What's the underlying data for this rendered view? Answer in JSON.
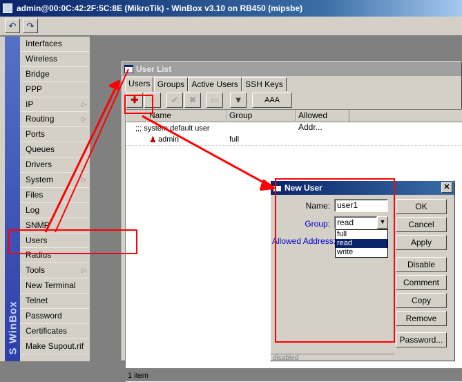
{
  "window_title": "admin@00:0C:42:2F:5C:8E (MikroTik) - WinBox v3.10 on RB450 (mipsbe)",
  "toolbar": {
    "undo": "↶",
    "redo": "↷"
  },
  "sidebar": {
    "brand": "S WinBox",
    "items": [
      {
        "label": "Interfaces"
      },
      {
        "label": "Wireless"
      },
      {
        "label": "Bridge"
      },
      {
        "label": "PPP"
      },
      {
        "label": "IP",
        "sub": "▷"
      },
      {
        "label": "Routing",
        "sub": "▷"
      },
      {
        "label": "Ports"
      },
      {
        "label": "Queues"
      },
      {
        "label": "Drivers"
      },
      {
        "label": "System",
        "sub": "▷"
      },
      {
        "label": "Files"
      },
      {
        "label": "Log"
      },
      {
        "label": "SNMP"
      },
      {
        "label": "Users"
      },
      {
        "label": "Radius"
      },
      {
        "label": "Tools",
        "sub": "▷"
      },
      {
        "label": "New Terminal"
      },
      {
        "label": "Telnet"
      },
      {
        "label": "Password"
      },
      {
        "label": "Certificates"
      },
      {
        "label": "Make Supout.rif"
      }
    ]
  },
  "user_list": {
    "title": "User List",
    "tabs": [
      "Users",
      "Groups",
      "Active Users",
      "SSH Keys"
    ],
    "tools": {
      "add": "✚",
      "remove": "−",
      "enable": "✔",
      "disable": "✖",
      "comment": "▭",
      "filter": "▼",
      "aaa": "AAA"
    },
    "columns": [
      "Name",
      "Group",
      "Allowed Addr..."
    ],
    "comment_row": ";;; system default user",
    "rows": [
      {
        "name": "admin",
        "group": "full",
        "allowed": ""
      }
    ],
    "status": "1 item"
  },
  "new_user": {
    "title": "New User",
    "close": "✕",
    "name_label": "Name:",
    "name_value": "user1",
    "group_label": "Group:",
    "group_value": "read",
    "allowed_label": "Allowed Address:",
    "group_options": [
      "full",
      "read",
      "write"
    ],
    "buttons": [
      "OK",
      "Cancel",
      "Apply",
      "Disable",
      "Comment",
      "Copy",
      "Remove",
      "Password..."
    ],
    "status": "disabled"
  },
  "colors": {
    "annotation": "#ff0000",
    "selection": "#0a246a"
  }
}
